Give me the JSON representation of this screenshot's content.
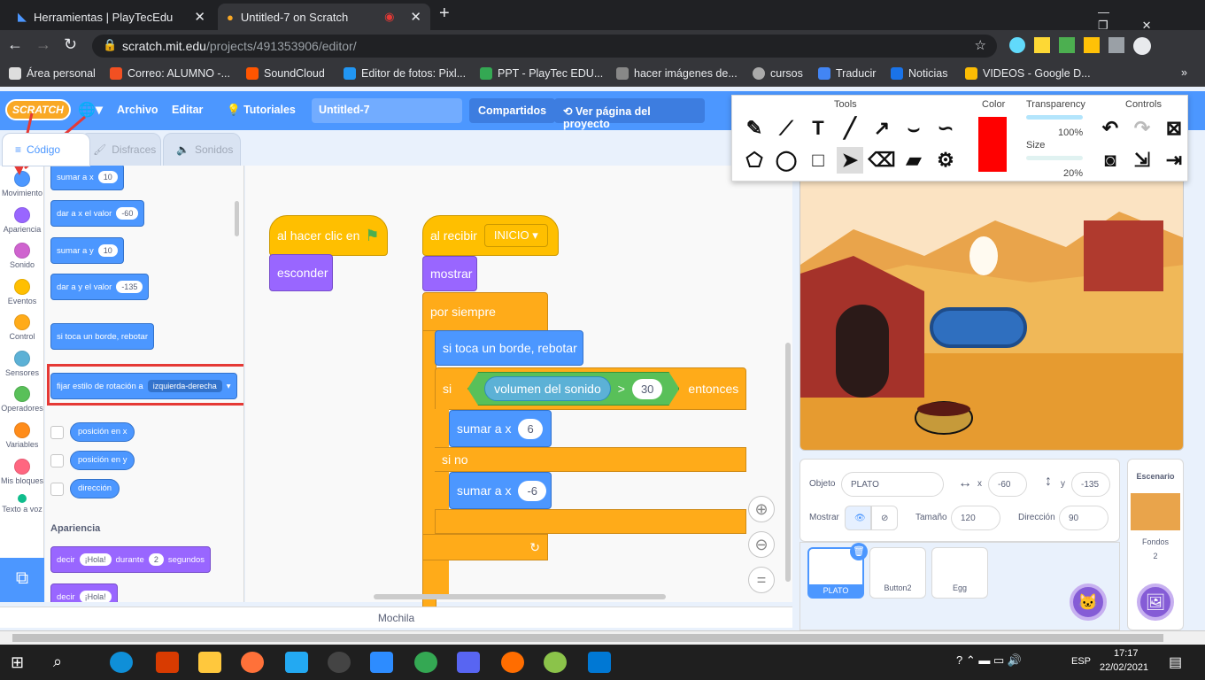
{
  "browser": {
    "tabs": [
      {
        "title": "Herramientas | PlayTecEdu"
      },
      {
        "title": "Untitled-7 on Scratch"
      }
    ],
    "new_tab": "+",
    "url_host": "scratch.mit.edu",
    "url_path": "/projects/491353906/editor/"
  },
  "bookmarks": [
    "Área personal",
    "Correo: ALUMNO -...",
    "SoundCloud",
    "Editor de fotos: Pixl...",
    "PPT - PlayTec EDU...",
    "hacer imágenes de...",
    "cursos",
    "Traducir",
    "Noticias",
    "VIDEOS - Google D..."
  ],
  "menu": {
    "logo": "SCRATCH",
    "file": "Archivo",
    "edit": "Editar",
    "tutorials": "Tutoriales",
    "project_title": "Untitled-7",
    "share": "Compartidos",
    "see_project": "Ver página del proyecto"
  },
  "tabs": {
    "code": "Código",
    "costumes": "Disfraces",
    "sounds": "Sonidos"
  },
  "categories": [
    {
      "label": "Movimiento",
      "color": "#4c97ff"
    },
    {
      "label": "Apariencia",
      "color": "#9966ff"
    },
    {
      "label": "Sonido",
      "color": "#cf63cf"
    },
    {
      "label": "Eventos",
      "color": "#ffbf00"
    },
    {
      "label": "Control",
      "color": "#ffab19"
    },
    {
      "label": "Sensores",
      "color": "#5cb1d6"
    },
    {
      "label": "Operadores",
      "color": "#59c059"
    },
    {
      "label": "Variables",
      "color": "#ff8c1a"
    },
    {
      "label": "Mis bloques",
      "color": "#ff6680"
    },
    {
      "label": "Texto a voz",
      "color": "#0fbd8c"
    }
  ],
  "palette": {
    "b1": "sumar a x",
    "b1v": "10",
    "b2": "dar a x el valor",
    "b2v": "-60",
    "b3": "sumar a y",
    "b3v": "10",
    "b4": "dar a y el valor",
    "b4v": "-135",
    "b5": "si toca un borde, rebotar",
    "b6": "fijar estilo de rotación a",
    "b6v": "izquierda-derecha",
    "r1": "posición en x",
    "r2": "posición en y",
    "r3": "dirección",
    "section": "Apariencia",
    "l1a": "decir",
    "l1b": "¡Hola!",
    "l1c": "durante",
    "l1d": "2",
    "l1e": "segundos",
    "l2a": "decir",
    "l2b": "¡Hola!"
  },
  "script1": {
    "hat": "al hacer clic en",
    "flag": "⚑",
    "b1": "esconder"
  },
  "script2": {
    "hat": "al recibir",
    "msg": "INICIO",
    "b1": "mostrar",
    "forever": "por siempre",
    "bounce": "si toca un borde, rebotar",
    "if": "si",
    "sensor": "volumen del sonido",
    "op": ">",
    "opv": "30",
    "then": "entonces",
    "m1": "sumar a x",
    "m1v": "6",
    "else": "si no",
    "m2": "sumar a x",
    "m2v": "-6",
    "loop": "↻"
  },
  "backpack": "Mochila",
  "tools": {
    "tools_label": "Tools",
    "color_label": "Color",
    "transparency_label": "Transparency",
    "transparency_val": "100%",
    "size_label": "Size",
    "size_val": "20%",
    "controls_label": "Controls",
    "color": "#ff0000"
  },
  "sprite_info": {
    "obj_label": "Objeto",
    "obj": "PLATO",
    "x_label": "x",
    "x": "-60",
    "y_label": "y",
    "y": "-135",
    "show_label": "Mostrar",
    "size_label": "Tamaño",
    "size": "120",
    "dir_label": "Dirección",
    "dir": "90"
  },
  "sprites": [
    "PLATO",
    "Button2",
    "Egg"
  ],
  "backdrop": {
    "label": "Escenario",
    "fondos": "Fondos",
    "count": "2"
  },
  "taskbar": {
    "lang": "ESP",
    "time": "17:17",
    "date": "22/02/2021"
  }
}
